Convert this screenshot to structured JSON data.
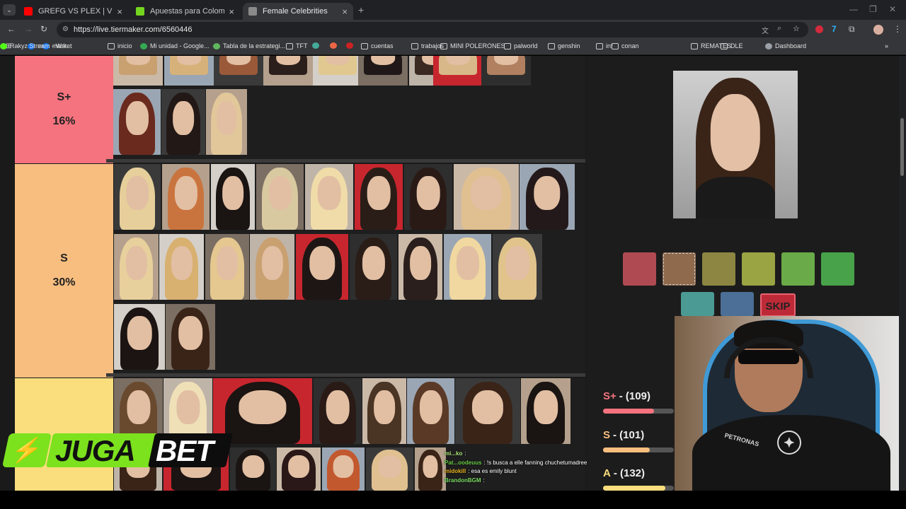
{
  "tabs": [
    {
      "title": "GREFG VS PLEX | VELADA DEL AÑO",
      "favicon_color": "#ff0000"
    },
    {
      "title": "Apuestas para Colombia vs Francia",
      "favicon_color": "#74d61f"
    },
    {
      "title": "Female Celebrities",
      "favicon_color": "#8a8a8a"
    }
  ],
  "new_tab_symbol": "+",
  "url": "https://live.tiermaker.com/6560446",
  "bookmarks": [
    {
      "label": "msn",
      "icon": "facebook-icon"
    },
    {
      "label": "market",
      "icon": "facebook-icon"
    },
    {
      "label": "inicio",
      "icon": "folder-icon"
    },
    {
      "label": "Mi unidad - Google...",
      "icon": "drive-icon"
    },
    {
      "label": "Tabla de la estrategi...",
      "icon": "link-icon"
    },
    {
      "label": "TFT",
      "icon": "folder-icon"
    },
    {
      "label": "cuentas",
      "icon": "folder-icon"
    },
    {
      "label": "trabajos",
      "icon": "folder-icon"
    },
    {
      "label": "MINI POLERONES",
      "icon": "folder-icon"
    },
    {
      "label": "palworld",
      "icon": "folder-icon"
    },
    {
      "label": "genshin",
      "icon": "folder-icon"
    },
    {
      "label": "inf",
      "icon": "folder-icon"
    },
    {
      "label": "conan",
      "icon": "folder-icon"
    },
    {
      "label": "REMATES",
      "icon": "folder-icon"
    },
    {
      "label": "DLE",
      "icon": "folder-icon"
    },
    {
      "label": "Dashboard",
      "icon": "globe-icon"
    },
    {
      "label": "Rakyz Stream - Wat...",
      "icon": "kick-icon"
    }
  ],
  "tiers": [
    {
      "name": "S+",
      "percent": "16%",
      "color": "#f4737e"
    },
    {
      "name": "S",
      "percent": "30%",
      "color": "#f8be7f"
    },
    {
      "name": "A",
      "percent": "",
      "color": "#fade7d"
    }
  ],
  "swatch_colors": [
    "#b04a52",
    "#8f6a4d",
    "#8c8642",
    "#9aa443",
    "#6aaa48",
    "#48a249",
    "#4b9b94",
    "#4b6f96"
  ],
  "skip_label": "SKIP",
  "scores": [
    {
      "label": "S+",
      "value": "- (109)",
      "color": "#f4737e",
      "fill": 0.72
    },
    {
      "label": "S",
      "value": "- (101)",
      "color": "#f8be7f",
      "fill": 0.66
    },
    {
      "label": "A",
      "value": "- (132)",
      "color": "#fade7d",
      "fill": 0.88
    }
  ],
  "chat": [
    {
      "user": "mi...ko",
      "text": ":",
      "color": "#aee87a"
    },
    {
      "user": "Pat...oodeuus",
      "text": ": !s busca a elle fanning chuchetumadree",
      "color": "#66cc44"
    },
    {
      "user": "midokill",
      "text": ": esa es emily blunt",
      "color": "#e6b422"
    },
    {
      "user": "BrandonBGM",
      "text": ":",
      "color": "#7ddf64"
    }
  ],
  "sponsor": {
    "part1": "JUGA",
    "part2": "BET"
  },
  "webcam_shirt_text": "PETRONAS"
}
